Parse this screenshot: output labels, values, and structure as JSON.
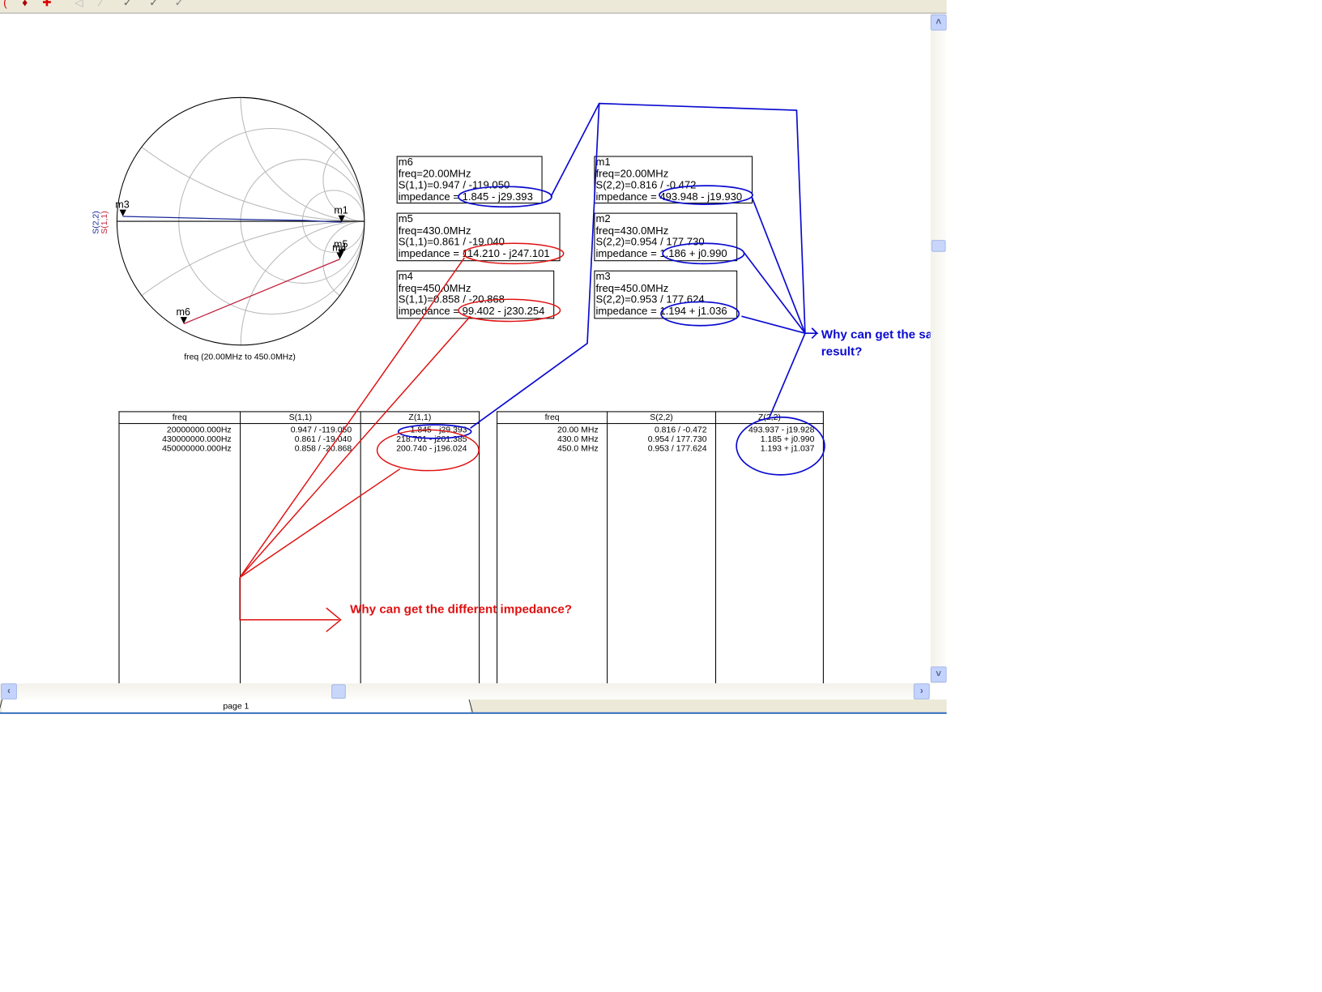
{
  "toolbar": {
    "icons": [
      "pen-icon",
      "marker-icon",
      "cross-marker-icon",
      "arrow-icon",
      "line-icon",
      "check-icon",
      "check-icon",
      "check-icon"
    ]
  },
  "smith_chart": {
    "legend": [
      "S(2,2)",
      "S(1,1)"
    ],
    "xlabel": "freq (20.00MHz to 450.0MHz)",
    "trace_colors": {
      "S(2,2)": "#1a2a9a",
      "S(1,1)": "#c0203a"
    },
    "markers": [
      {
        "label": "m3",
        "trace": "S(2,2)",
        "mag": 0.953,
        "ang": 177.624
      },
      {
        "label": "m1",
        "trace": "S(2,2)",
        "mag": 0.816,
        "ang": -0.472
      },
      {
        "label": "m5",
        "trace": "S(1,1)",
        "mag": 0.861,
        "ang": -19.04
      },
      {
        "label": "m4",
        "trace": "S(1,1)",
        "mag": 0.858,
        "ang": -20.868
      },
      {
        "label": "m6",
        "trace": "S(1,1)",
        "mag": 0.947,
        "ang": -119.05
      }
    ]
  },
  "marker_boxes": [
    {
      "name": "m6",
      "freq": "freq=20.00MHz",
      "s": "S(1,1)=0.947 / -119.050",
      "imp": "impedance = 1.845 - j29.393"
    },
    {
      "name": "m5",
      "freq": "freq=430.0MHz",
      "s": "S(1,1)=0.861 / -19.040",
      "imp": "impedance = 114.210 - j247.101"
    },
    {
      "name": "m4",
      "freq": "freq=450.0MHz",
      "s": "S(1,1)=0.858 / -20.868",
      "imp": "impedance = 99.402 - j230.254"
    },
    {
      "name": "m1",
      "freq": "freq=20.00MHz",
      "s": "S(2,2)=0.816 / -0.472",
      "imp": "impedance = 493.948 - j19.930"
    },
    {
      "name": "m2",
      "freq": "freq=430.0MHz",
      "s": "S(2,2)=0.954 / 177.730",
      "imp": "impedance = 1.186 + j0.990"
    },
    {
      "name": "m3",
      "freq": "freq=450.0MHz",
      "s": "S(2,2)=0.953 / 177.624",
      "imp": "impedance = 1.194 + j1.036"
    }
  ],
  "table1": {
    "headers": [
      "freq",
      "S(1,1)",
      "Z(1,1)"
    ],
    "freq": "20000000.000Hz\n430000000.000Hz\n450000000.000Hz",
    "s": "0.947 / -119.050\n0.861 / -19.040\n0.858 / -20.868",
    "z": "1.845 - j29.393\n218.701 - j201.385\n200.740 - j196.024"
  },
  "table2": {
    "headers": [
      "freq",
      "S(2,2)",
      "Z(2,2)"
    ],
    "freq": "20.00 MHz\n430.0 MHz\n450.0 MHz",
    "s": "0.816 / -0.472\n0.954 / 177.730\n0.953 / 177.624",
    "z": "493.937 - j19.928\n1.185 + j0.990\n1.193 + j1.037"
  },
  "annotations": {
    "red_question": "Why can get the different impedance?",
    "blue_question": "Why can get the same result?",
    "red_color": "#e01010",
    "blue_color": "#0a0ad0"
  },
  "tabs": {
    "page": "page 1"
  },
  "scroll": {
    "up": "˄",
    "down": "˅",
    "left": "‹",
    "right": "›"
  }
}
